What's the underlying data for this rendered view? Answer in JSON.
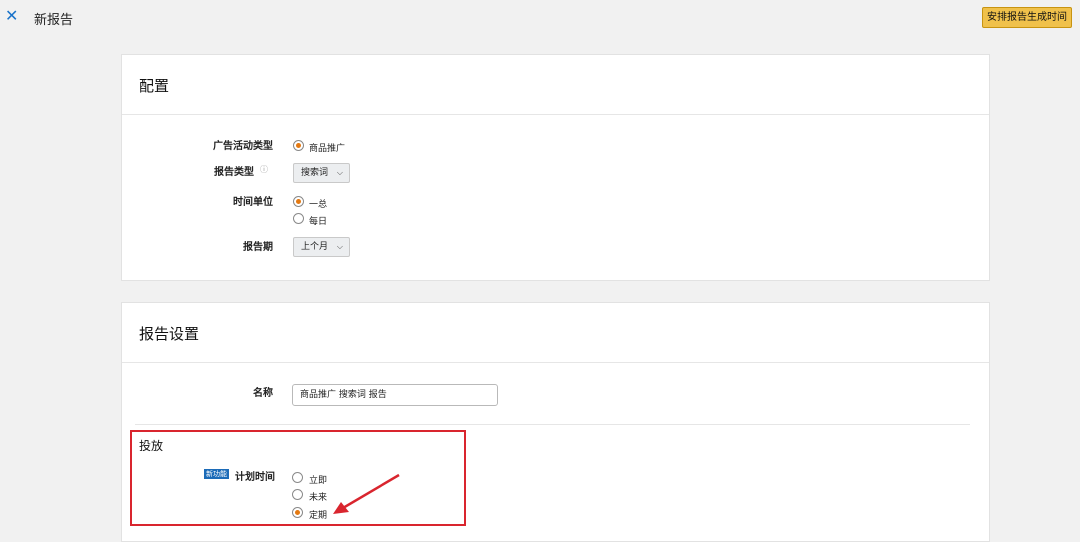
{
  "header": {
    "close_glyph": "✕",
    "title": "新报告",
    "schedule_button": "安排报告生成时间"
  },
  "config": {
    "title": "配置",
    "ad_type": {
      "label": "广告活动类型",
      "option": "商品推广"
    },
    "report_type": {
      "label": "报告类型",
      "info_glyph": "ⓘ",
      "value": "搜索词"
    },
    "time_unit": {
      "label": "时间单位",
      "options": [
        "一总",
        "每日"
      ],
      "selected": 0
    },
    "period": {
      "label": "报告期",
      "value": "上个月"
    }
  },
  "report_settings": {
    "title": "报告设置",
    "name": {
      "label": "名称",
      "value": "商品推广 搜索词 报告"
    },
    "delivery": {
      "title": "投放",
      "badge": "新功能",
      "schedule_label": "计划时间",
      "options": [
        "立即",
        "未来",
        "定期"
      ],
      "selected": 2
    }
  },
  "colors": {
    "accent": "#f0c14b",
    "highlight": "#d9252e",
    "radio_fill": "#e47911"
  },
  "icons": {
    "close": "close-icon",
    "chevron": "chevron-down-icon",
    "info": "info-icon",
    "arrow": "annotation-arrow-icon"
  }
}
